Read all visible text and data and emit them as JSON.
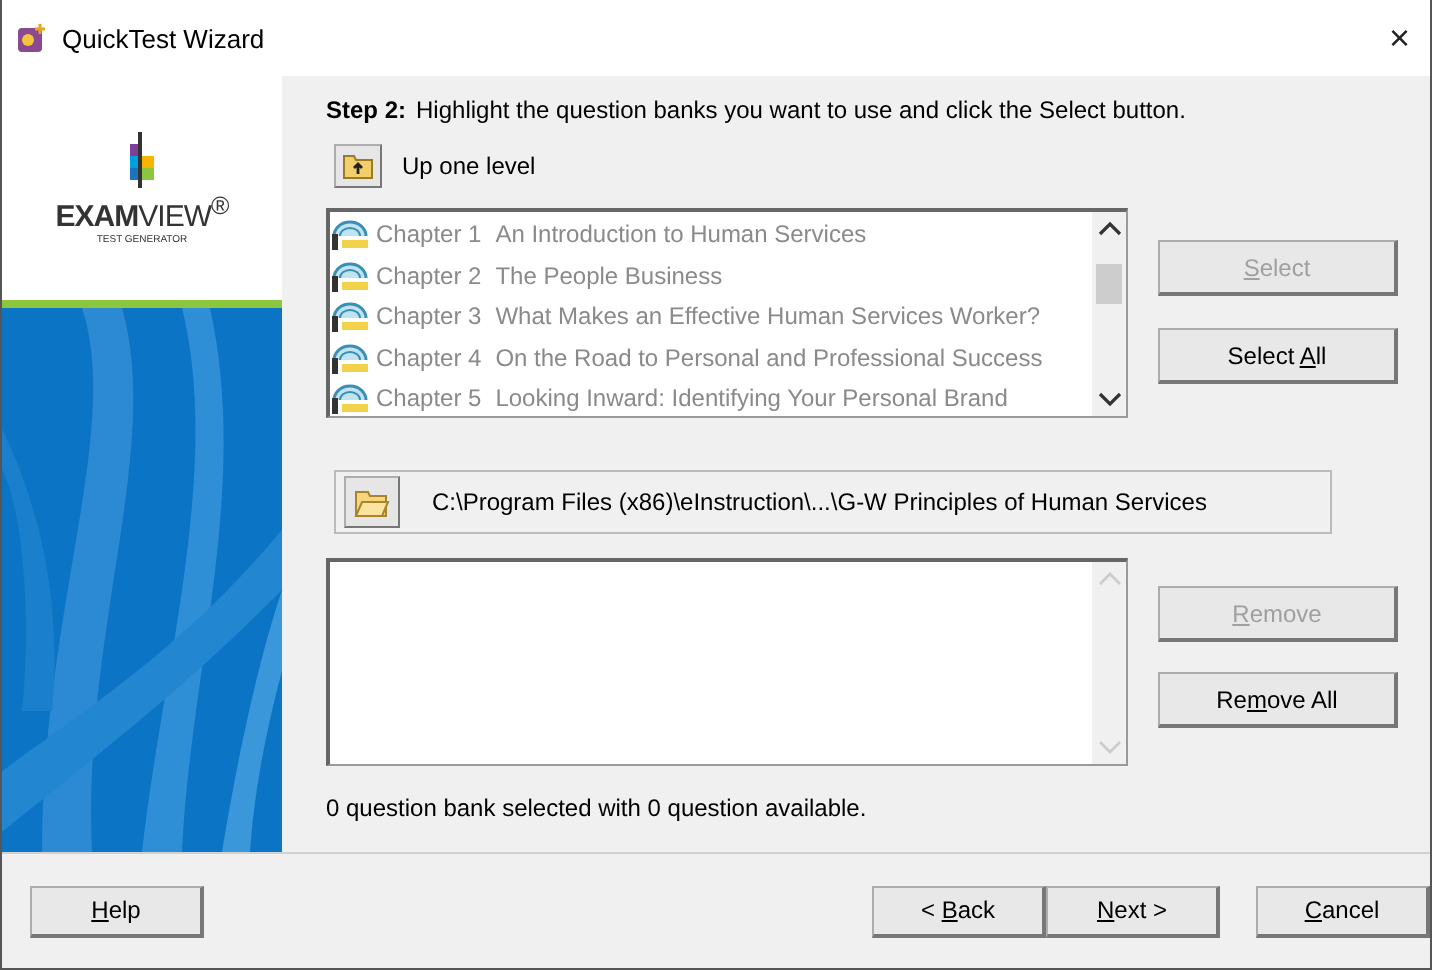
{
  "window": {
    "title": "QuickTest Wizard",
    "close": "×"
  },
  "logo": {
    "name": "**EXAM**VIEW$^{®}$",
    "tagline": "TEST GENERATOR"
  },
  "step": {
    "label": "Step 2:",
    "text": "Highlight the question banks you want to use and click the Select button."
  },
  "up_button": {
    "label": "Up one level"
  },
  "banks": [
    {
      "chapter": "Chapter 1",
      "title": "An Introduction to Human Services"
    },
    {
      "chapter": "Chapter 2",
      "title": "The People Business"
    },
    {
      "chapter": "Chapter 3",
      "title": "What Makes an Effective Human Services Worker?"
    },
    {
      "chapter": "Chapter 4",
      "title": "On the Road to Personal and Professional Success"
    },
    {
      "chapter": "Chapter 5",
      "title": "Looking Inward: Identifying Your Personal Brand"
    }
  ],
  "select_buttons": [
    {
      "key": "S",
      "after": "elect",
      "disabled": true
    },
    {
      "before": "Select ",
      "key": "A",
      "after": "ll",
      "disabled": false
    }
  ],
  "path": "C:\\Program Files (x86)\\eInstruction\\...\\G-W Principles of Human Services",
  "remove_buttons": [
    {
      "key": "R",
      "after": "emove",
      "disabled": true
    },
    {
      "before": "Re",
      "key": "m",
      "after": "ove All",
      "disabled": false
    }
  ],
  "status": "0 question bank selected with 0 question available.",
  "footer": {
    "help": {
      "key": "H",
      "after": "elp"
    },
    "nav": [
      {
        "before": "< ",
        "key": "B",
        "after": "ack"
      },
      {
        "key": "N",
        "after": "ext >"
      }
    ],
    "cancel": {
      "key": "C",
      "after": "ancel"
    }
  }
}
